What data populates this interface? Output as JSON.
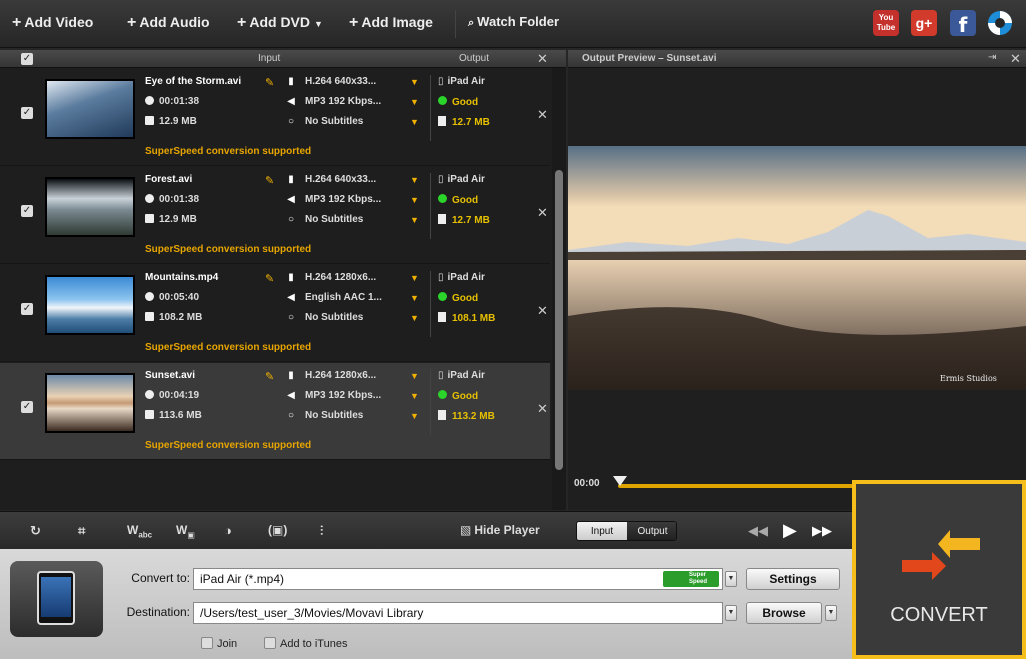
{
  "toolbar": {
    "add_video": "Add Video",
    "add_audio": "Add Audio",
    "add_dvd": "Add DVD",
    "add_image": "Add Image",
    "watch_folder": "Watch Folder",
    "youtube_top": "You",
    "youtube_bottom": "Tube",
    "gplus": "g+",
    "facebook": "f"
  },
  "list": {
    "input_header": "Input",
    "output_header": "Output",
    "items": [
      {
        "name": "Eye of the Storm.avi",
        "duration": "00:01:38",
        "size": "12.9 MB",
        "video": "H.264 640x33...",
        "audio": "MP3 192 Kbps...",
        "subs": "No Subtitles",
        "device": "iPad Air",
        "quality": "Good",
        "out_size": "12.7 MB",
        "note": "SuperSpeed conversion supported"
      },
      {
        "name": "Forest.avi",
        "duration": "00:01:38",
        "size": "12.9 MB",
        "video": "H.264 640x33...",
        "audio": "MP3 192 Kbps...",
        "subs": "No Subtitles",
        "device": "iPad Air",
        "quality": "Good",
        "out_size": "12.7 MB",
        "note": "SuperSpeed conversion supported"
      },
      {
        "name": "Mountains.mp4",
        "duration": "00:05:40",
        "size": "108.2 MB",
        "video": "H.264 1280x6...",
        "audio": "English AAC 1...",
        "subs": "No Subtitles",
        "device": "iPad Air",
        "quality": "Good",
        "out_size": "108.1 MB",
        "note": "SuperSpeed conversion supported"
      },
      {
        "name": "Sunset.avi",
        "duration": "00:04:19",
        "size": "113.6 MB",
        "video": "H.264 1280x6...",
        "audio": "MP3 192 Kbps...",
        "subs": "No Subtitles",
        "device": "iPad Air",
        "quality": "Good",
        "out_size": "113.2 MB",
        "note": "SuperSpeed conversion supported"
      }
    ]
  },
  "preview": {
    "title": "Output Preview – Sunset.avi",
    "time": "00:00",
    "watermark": "Ermis Studios"
  },
  "tools": {
    "hide_player": "Hide Player",
    "input_tab": "Input",
    "output_tab": "Output"
  },
  "bottom": {
    "convert_to_label": "Convert to:",
    "convert_to_value": "iPad Air (*.mp4)",
    "superspeed_top": "Super",
    "superspeed_bottom": "Speed",
    "settings": "Settings",
    "destination_label": "Destination:",
    "destination_value": "/Users/test_user_3/Movies/Movavi Library",
    "browse": "Browse",
    "join": "Join",
    "itunes": "Add to iTunes"
  },
  "convert": {
    "label": "CONVERT"
  },
  "colors": {
    "accent": "#f5be1b",
    "good": "#2bd42b",
    "orange": "#e7a500"
  }
}
